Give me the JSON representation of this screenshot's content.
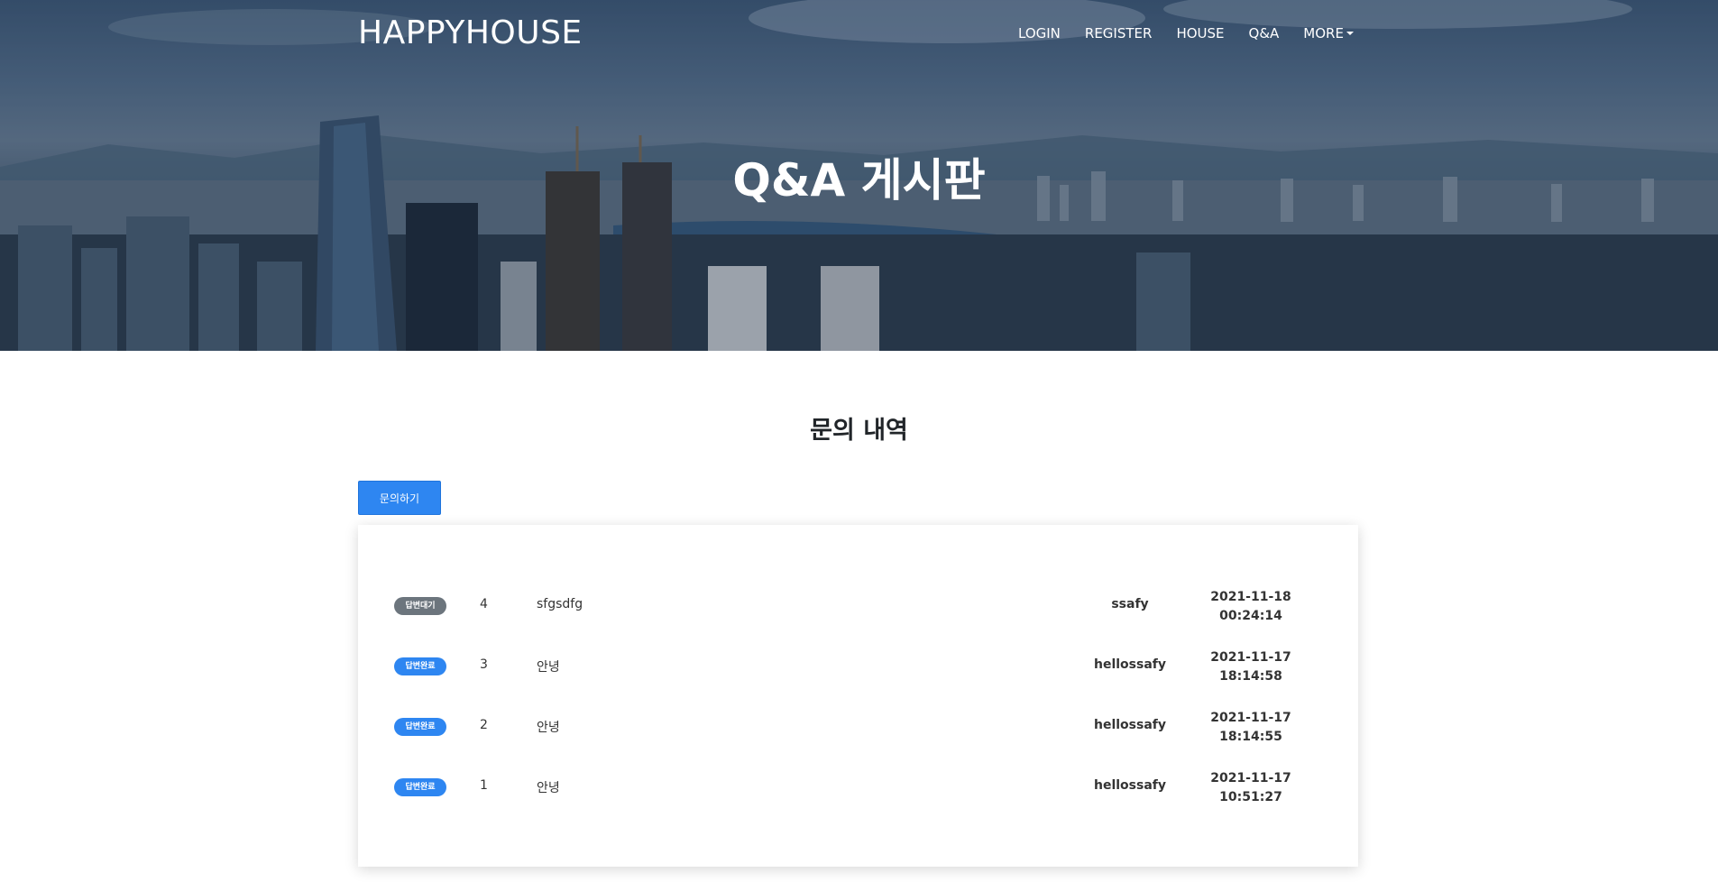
{
  "brand": {
    "name": "HAPPYHOUSE"
  },
  "nav": {
    "items": [
      {
        "label": "LOGIN"
      },
      {
        "label": "REGISTER"
      },
      {
        "label": "HOUSE"
      },
      {
        "label": "Q&A"
      },
      {
        "label": "MORE"
      }
    ]
  },
  "hero": {
    "title": "Q&A 게시판"
  },
  "section": {
    "title": "문의 내역"
  },
  "toolbar": {
    "ask_label": "문의하기"
  },
  "qa_list": [
    {
      "status": "답변대기",
      "status_type": "pending",
      "num": "4",
      "title": "sfgsdfg",
      "writer": "ssafy",
      "date": "2021-11-18",
      "time": "00:24:14"
    },
    {
      "status": "답변완료",
      "status_type": "done",
      "num": "3",
      "title": "안녕",
      "writer": "hellossafy",
      "date": "2021-11-17",
      "time": "18:14:58"
    },
    {
      "status": "답변완료",
      "status_type": "done",
      "num": "2",
      "title": "안녕",
      "writer": "hellossafy",
      "date": "2021-11-17",
      "time": "18:14:55"
    },
    {
      "status": "답변완료",
      "status_type": "done",
      "num": "1",
      "title": "안녕",
      "writer": "hellossafy",
      "date": "2021-11-17",
      "time": "10:51:27"
    }
  ],
  "colors": {
    "primary": "#2e86f1",
    "pending": "#6c757d",
    "text": "#212529"
  }
}
